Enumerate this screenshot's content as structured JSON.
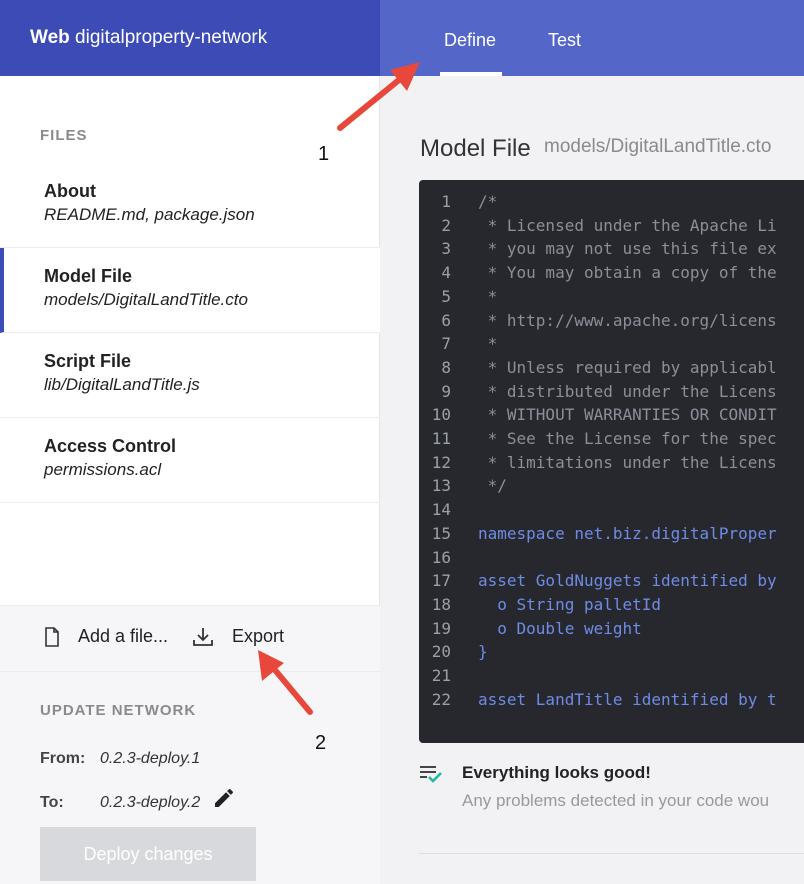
{
  "header": {
    "brand_bold": "Web",
    "brand_name": "digitalproperty-network",
    "tabs": [
      "Define",
      "Test"
    ]
  },
  "sidebar": {
    "files_heading": "FILES",
    "files": [
      {
        "title": "About",
        "subtitle": "README.md, package.json"
      },
      {
        "title": "Model File",
        "subtitle": "models/DigitalLandTitle.cto"
      },
      {
        "title": "Script File",
        "subtitle": "lib/DigitalLandTitle.js"
      },
      {
        "title": "Access Control",
        "subtitle": "permissions.acl"
      }
    ],
    "add_file": "Add a file...",
    "export": "Export",
    "update": {
      "heading": "UPDATE NETWORK",
      "from_label": "From:",
      "from_value": "0.2.3-deploy.1",
      "to_label": "To:",
      "to_value": "0.2.3-deploy.2",
      "deploy_label": "Deploy changes"
    }
  },
  "main": {
    "title": "Model File",
    "subtitle": "models/DigitalLandTitle.cto",
    "code_lines": [
      "/*",
      " * Licensed under the Apache Li",
      " * you may not use this file ex",
      " * You may obtain a copy of the",
      " *",
      " * http://www.apache.org/licens",
      " *",
      " * Unless required by applicabl",
      " * distributed under the Licens",
      " * WITHOUT WARRANTIES OR CONDIT",
      " * See the License for the spec",
      " * limitations under the Licens",
      " */",
      "",
      "namespace net.biz.digitalProper",
      "",
      "asset GoldNuggets identified by",
      "  o String palletId",
      "  o Double weight",
      "}",
      "",
      "asset LandTitle identified by t"
    ],
    "status_title": "Everything looks good!",
    "status_sub": "Any problems detected in your code wou"
  },
  "annotations": [
    "1",
    "2"
  ],
  "colors": {
    "brand_bg": "#3c4bb5",
    "nav_bg": "#5566c9",
    "code_bg": "#26282e",
    "arrow": "#e8483b",
    "check": "#2bb5a3"
  }
}
